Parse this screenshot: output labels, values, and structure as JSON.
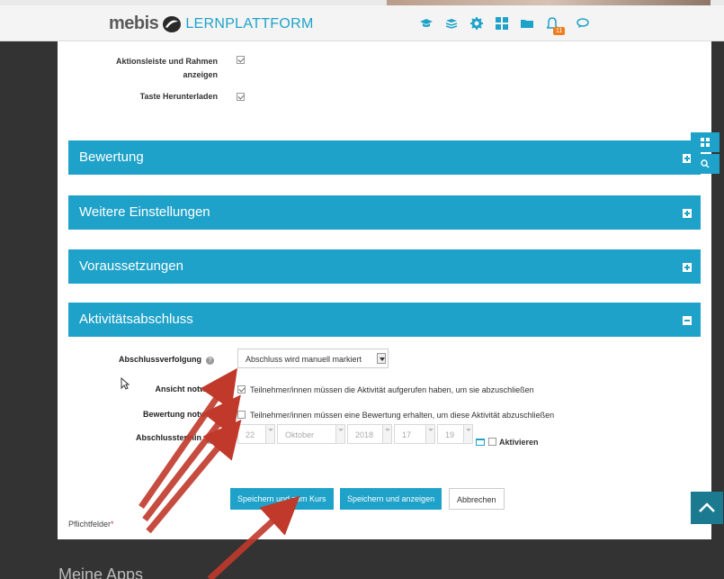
{
  "header": {
    "brand_mebis": "mebis",
    "brand_lern": "LERNPLATTFORM",
    "notification_count": "11",
    "icons": [
      "graduation-cap-icon",
      "courses-icon",
      "gear-icon",
      "grid-icon",
      "folder-icon",
      "bell-icon",
      "chat-icon"
    ]
  },
  "form": {
    "option_toolbar_label": "Aktionsleiste und Rahmen anzeigen",
    "option_download_label": "Taste Herunterladen",
    "sections": {
      "bewertung": "Bewertung",
      "weitere": "Weitere Einstellungen",
      "voraussetzungen": "Voraussetzungen",
      "abschluss": "Aktivitätsabschluss"
    },
    "completion": {
      "tracking_label": "Abschlussverfolgung",
      "tracking_value": "Abschluss wird manuell markiert",
      "view_label": "Ansicht notwendig",
      "view_text": "Teilnehmer/innen müssen die Aktivität aufgerufen haben, um sie abzuschließen",
      "grade_label": "Bewertung notwendig",
      "grade_text": "Teilnehmer/innen müssen eine Bewertung erhalten, um diese Aktivität abzuschließen",
      "expected_label": "Abschlusstermin",
      "date": {
        "day": "22",
        "month": "Oktober",
        "year": "2018",
        "hour": "17",
        "minute": "19"
      },
      "enable_label": "Aktivieren"
    },
    "buttons": {
      "save_return": "Speichern und zum Kurs",
      "save_display": "Speichern und anzeigen",
      "cancel": "Abbrechen"
    },
    "required_label": "Pflichtfelder"
  },
  "footer": {
    "meine_apps": "Meine Apps"
  },
  "colors": {
    "accent": "#1fa2c9",
    "arrow": "#c0392b",
    "badge": "#f07d1b"
  }
}
